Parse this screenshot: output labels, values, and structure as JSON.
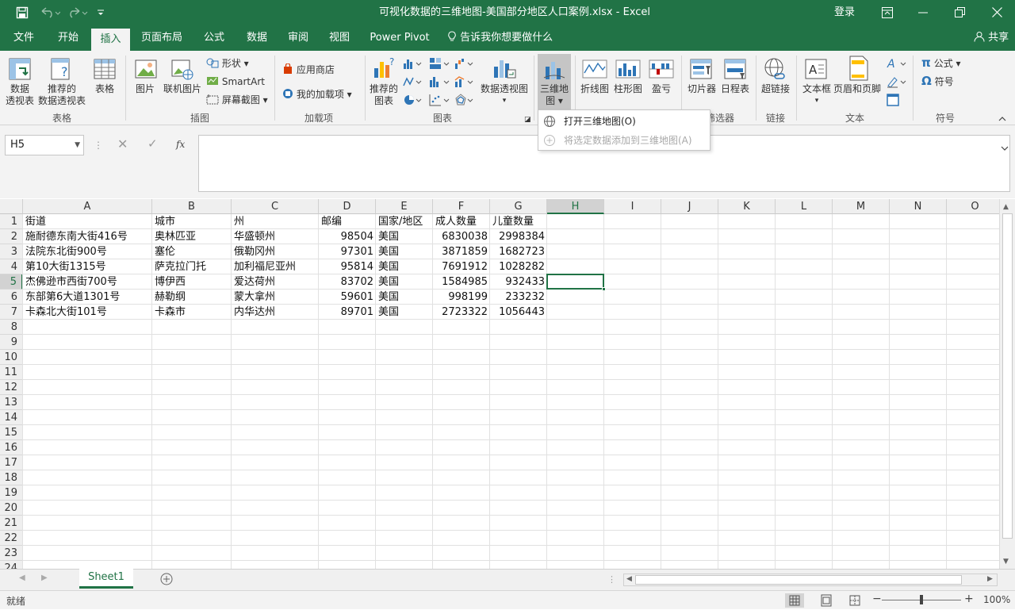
{
  "title": {
    "doc_title": "可视化数据的三维地图-美国部分地区人口案例.xlsx",
    "sep": "-",
    "app": "Excel",
    "login": "登录"
  },
  "tabs": [
    "文件",
    "开始",
    "插入",
    "页面布局",
    "公式",
    "数据",
    "审阅",
    "视图",
    "Power Pivot"
  ],
  "tellme": "告诉我你想要做什么",
  "share": "共享",
  "ribbon": {
    "groups": {
      "tables": "表格",
      "illustrations": "插图",
      "addins": "加载项",
      "charts": "图表",
      "filters": "筛选器",
      "links": "链接",
      "text": "文本",
      "symbols": "符号"
    },
    "pivot": [
      "数据",
      "透视表"
    ],
    "rec_pivot": [
      "推荐的",
      "数据透视表"
    ],
    "table": "表格",
    "picture": "图片",
    "online_picture": "联机图片",
    "shapes": "形状",
    "smartart": "SmartArt",
    "screenshot": "屏幕截图",
    "store": "应用商店",
    "my_addins": "我的加载项",
    "rec_charts": [
      "推荐的",
      "图表"
    ],
    "pivot_chart": "数据透视图",
    "map3d": [
      "三维地",
      "图"
    ],
    "line": "折线图",
    "column": "柱形图",
    "winloss": "盈亏",
    "slicer": "切片器",
    "timeline": "日程表",
    "hyperlink": "超链接",
    "textbox": "文本框",
    "header_footer": "页眉和页脚",
    "equation": "公式",
    "symbol": "符号"
  },
  "dropdown": {
    "open": "打开三维地图(O)",
    "add": "将选定数据添加到三维地图(A)"
  },
  "namebox": "H5",
  "fx": "fx",
  "columns": [
    "A",
    "B",
    "C",
    "D",
    "E",
    "F",
    "G",
    "H",
    "I",
    "J",
    "K",
    "L",
    "M",
    "N",
    "O"
  ],
  "rows": [
    "1",
    "2",
    "3",
    "4",
    "5",
    "6",
    "7",
    "8",
    "9",
    "10",
    "11",
    "12",
    "13",
    "14",
    "15",
    "16",
    "17",
    "18",
    "19",
    "20",
    "21",
    "22",
    "23",
    "24"
  ],
  "sheet": {
    "header": [
      "街道",
      "城市",
      "州",
      "邮编",
      "国家/地区",
      "成人数量",
      "儿童数量"
    ],
    "data": [
      [
        "施耐德东南大街416号",
        "奥林匹亚",
        "华盛顿州",
        "98504",
        "美国",
        "6830038",
        "2998384"
      ],
      [
        "法院东北街900号",
        "塞伦",
        "俄勒冈州",
        "97301",
        "美国",
        "3871859",
        "1682723"
      ],
      [
        "第10大街1315号",
        "萨克拉门托",
        "加利福尼亚州",
        "95814",
        "美国",
        "7691912",
        "1028282"
      ],
      [
        "杰佛逊市西街700号",
        "博伊西",
        "爱达荷州",
        "83702",
        "美国",
        "1584985",
        "932433"
      ],
      [
        "东部第6大道1301号",
        "赫勒纲",
        "蒙大拿州",
        "59601",
        "美国",
        "998199",
        "233232"
      ],
      [
        "卡森北大街101号",
        "卡森市",
        "内华达州",
        "89701",
        "美国",
        "2723322",
        "1056443"
      ]
    ]
  },
  "sheet_tab": "Sheet1",
  "status": {
    "ready": "就绪",
    "zoom": "100%"
  },
  "colors": {
    "brand": "#217346",
    "selection": "#217346"
  }
}
